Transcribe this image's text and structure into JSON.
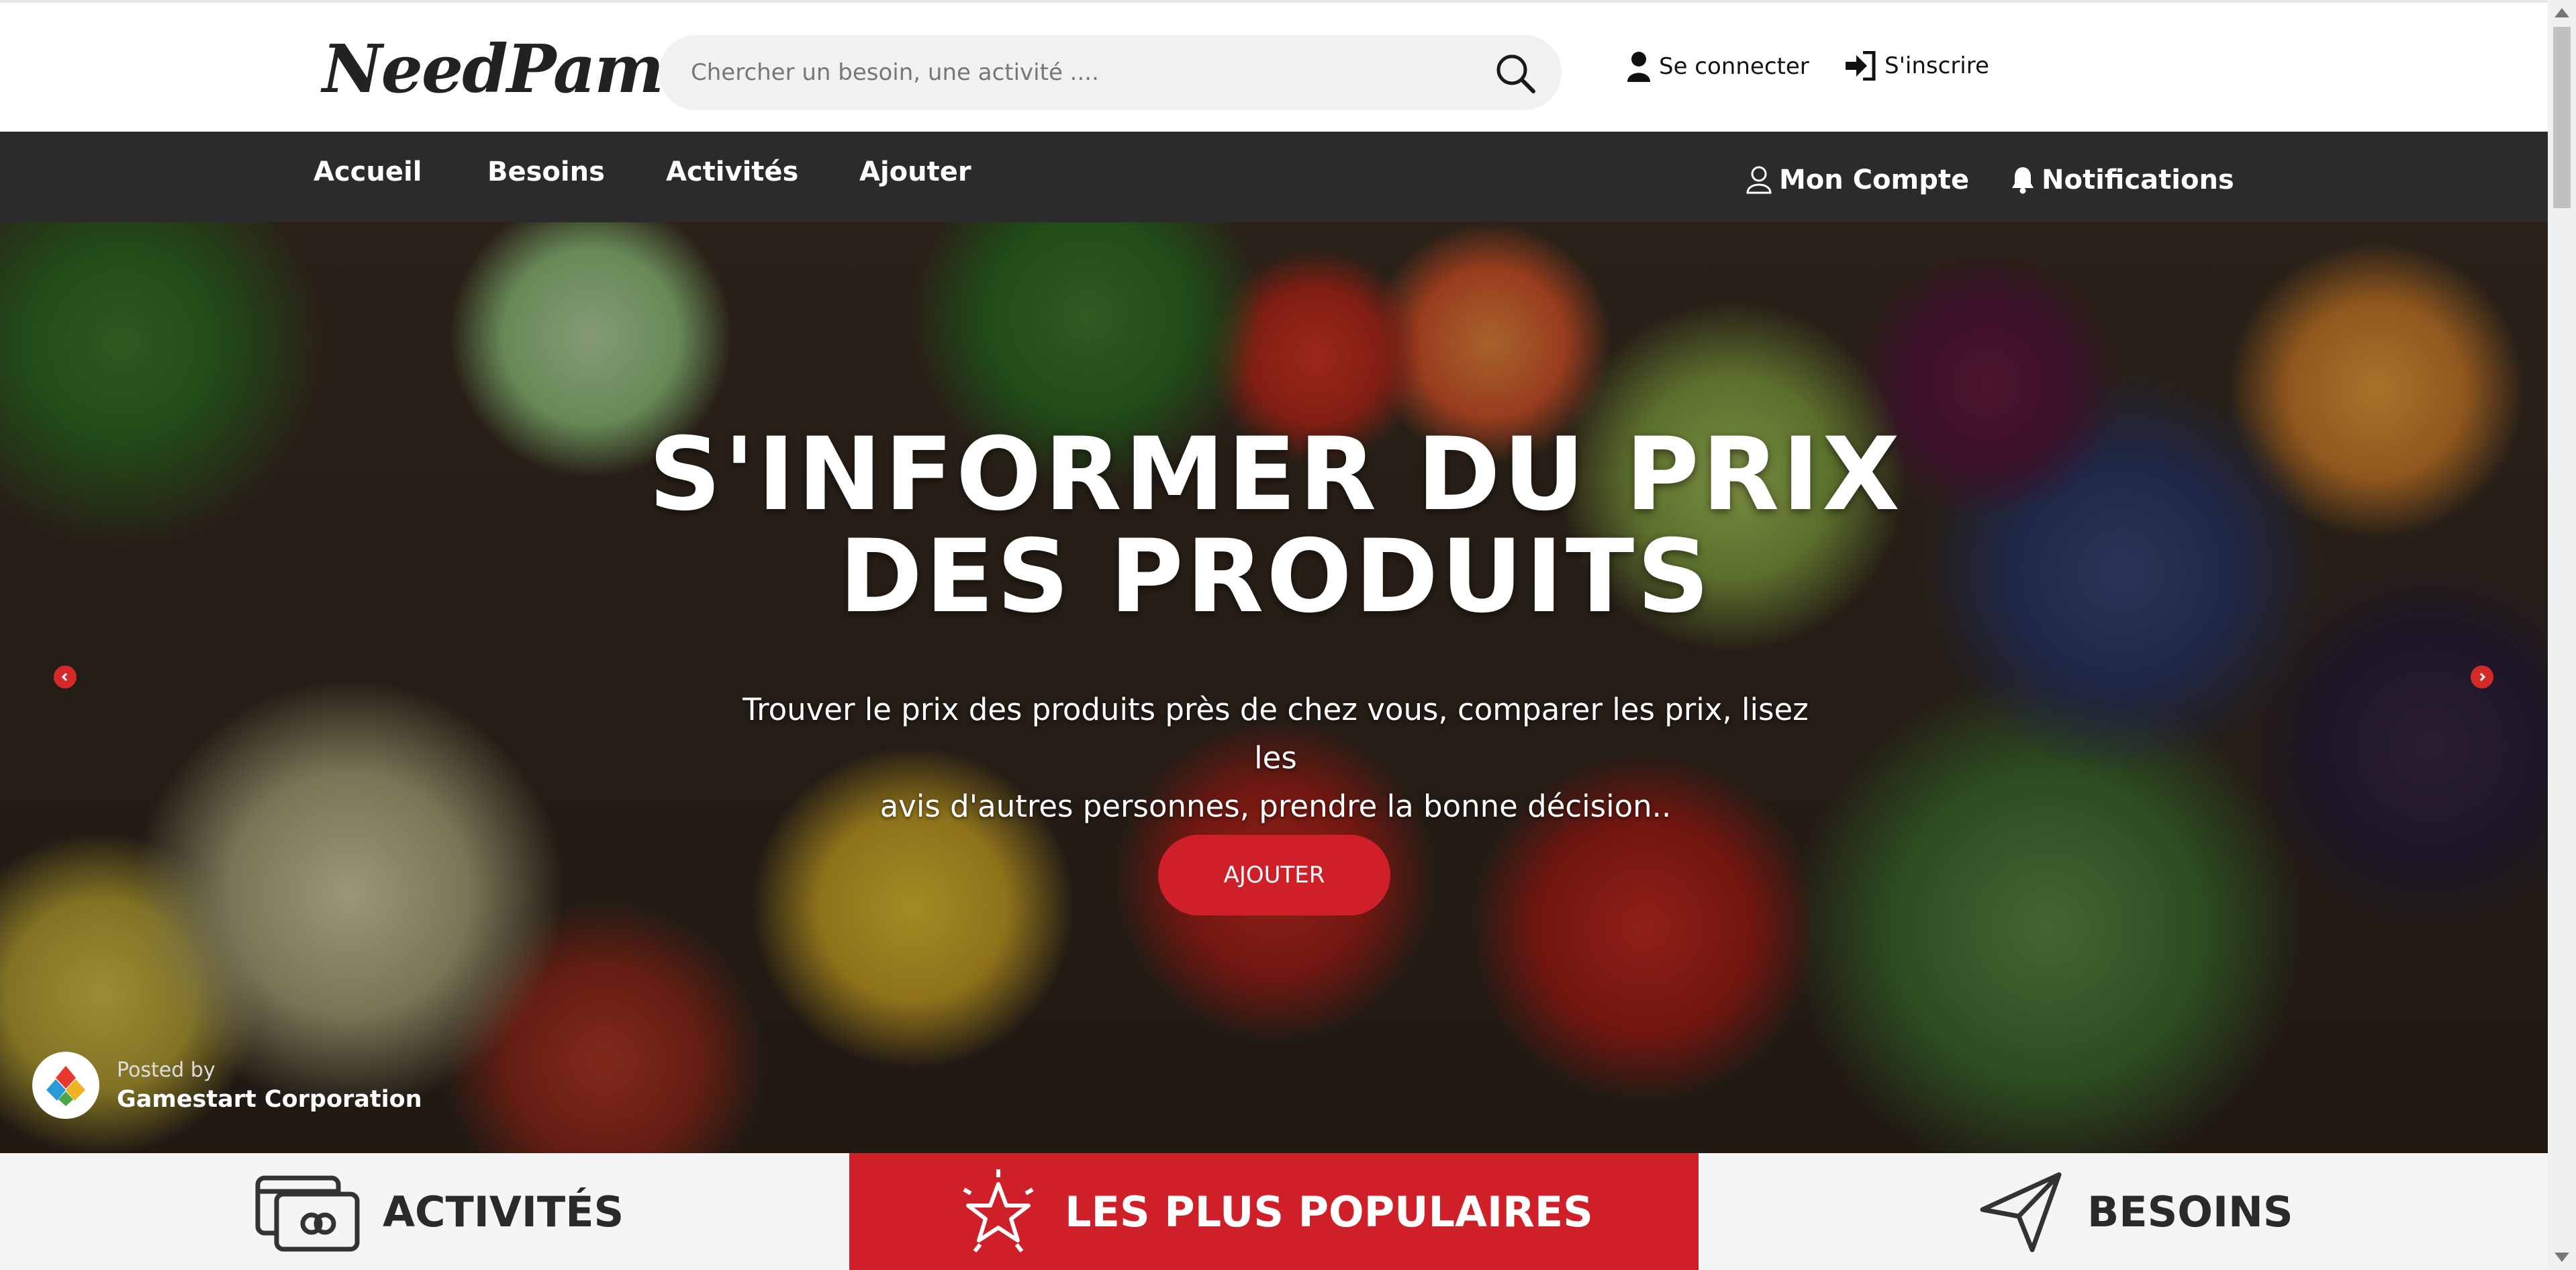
{
  "header": {
    "logo": "NeedPam",
    "search_placeholder": "Chercher un besoin, une activité ....",
    "login_label": "Se connecter",
    "signup_label": "S'inscrire"
  },
  "nav": {
    "items": [
      {
        "label": "Accueil"
      },
      {
        "label": "Besoins"
      },
      {
        "label": "Activités"
      },
      {
        "label": "Ajouter"
      }
    ],
    "account_label": "Mon Compte",
    "notifications_label": "Notifications"
  },
  "hero": {
    "title_line1": "S'INFORMER DU PRIX",
    "title_line2": "DES PRODUITS",
    "subtitle_line1": "Trouver le prix des produits près de chez vous, comparer les prix, lisez les",
    "subtitle_line2": "avis d'autres personnes, prendre la bonne décision..",
    "button_label": "AJOUTER",
    "posted_by_label": "Posted by",
    "posted_by_name": "Gamestart Corporation"
  },
  "tabs": [
    {
      "label": "ACTIVITÉS",
      "icon": "credit-card-icon"
    },
    {
      "label": "LES PLUS POPULAIRES",
      "icon": "star-icon"
    },
    {
      "label": "BESOINS",
      "icon": "paper-plane-icon"
    }
  ],
  "colors": {
    "accent_red": "#cf2029",
    "nav_bg": "#2b2b2b",
    "search_bg": "#f1f1f1"
  }
}
